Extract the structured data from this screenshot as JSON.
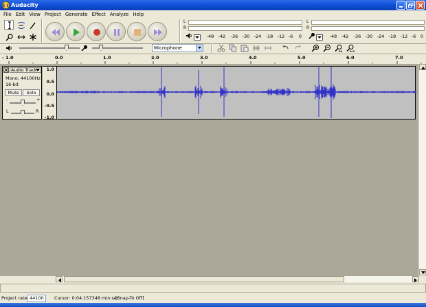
{
  "window": {
    "title": "Audacity"
  },
  "menu": [
    "File",
    "Edit",
    "View",
    "Project",
    "Generate",
    "Effect",
    "Analyze",
    "Help"
  ],
  "meters": {
    "playback": {
      "l": "L",
      "r": "R",
      "ticks": [
        "-48",
        "-42",
        "-36",
        "-30",
        "-24",
        "-18",
        "-12",
        "-6",
        "0"
      ]
    },
    "record": {
      "l": "L",
      "r": "R",
      "ticks": [
        "-48",
        "-42",
        "-36",
        "-30",
        "-24",
        "-18",
        "-12",
        "-6",
        "0"
      ]
    }
  },
  "mixer": {
    "input_source": "Microphone"
  },
  "ruler": {
    "labels": [
      "- 1.0",
      "0.0",
      "1.0",
      "2.0",
      "3.0",
      "4.0",
      "5.0",
      "6.0",
      "7.0"
    ]
  },
  "track": {
    "name": "Audio Track",
    "info1": "Mono, 44100Hz",
    "info2": "16-bit",
    "mute": "Mute",
    "solo": "Solo",
    "gain_minus": "-",
    "gain_plus": "+",
    "pan_l": "L",
    "pan_r": "R",
    "scale": [
      "1.0",
      "0.5",
      "0.0",
      "-0.5",
      "-1.0"
    ]
  },
  "status": {
    "rate_label": "Project rate:",
    "rate_value": "44100",
    "cursor": "Cursor: 0:04.157348 min:sec",
    "snap": "[Snap-To Off]"
  },
  "colors": {
    "waveform": "#3232c8",
    "track_bg": "#c0c0c0",
    "workspace": "#aca899",
    "titlebar": "#0f4fd6"
  }
}
